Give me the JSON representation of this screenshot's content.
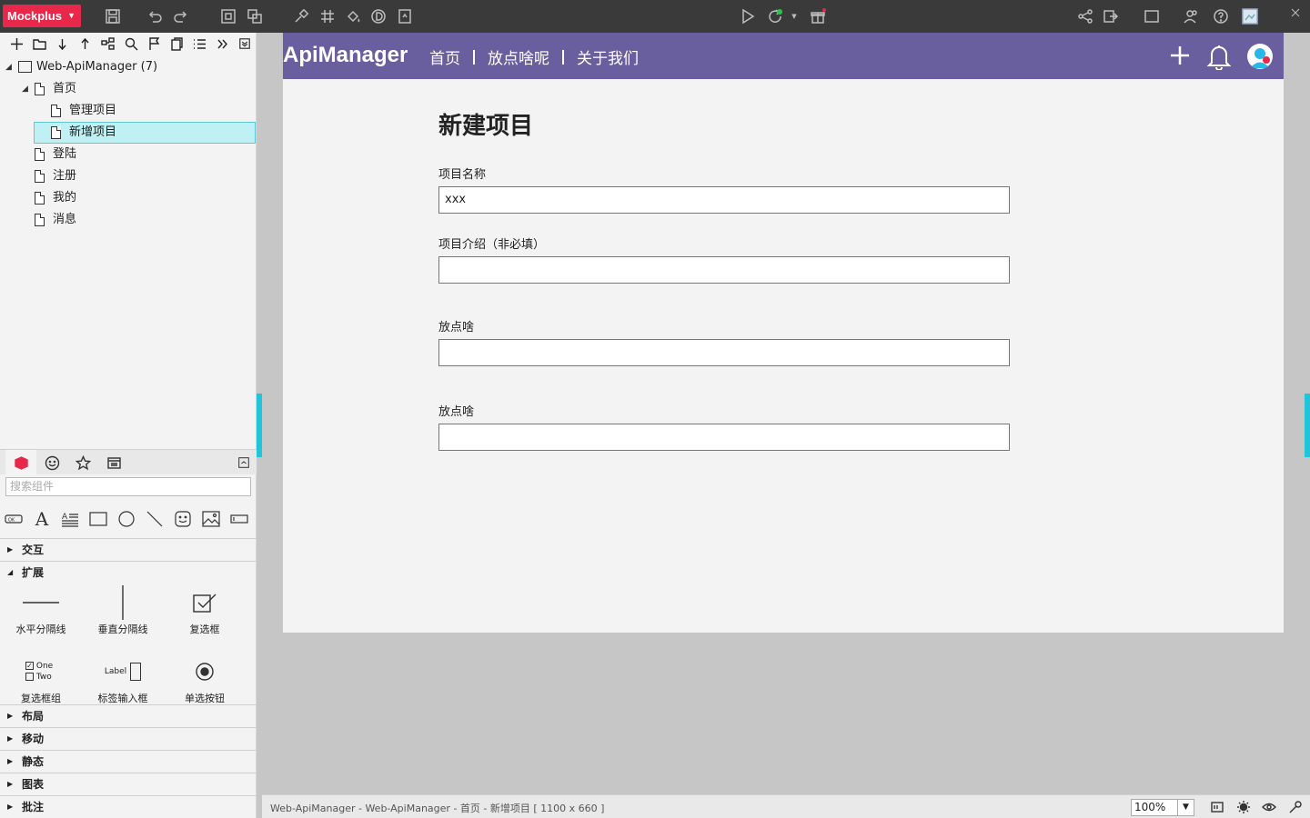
{
  "app": {
    "brand": "Mockplus"
  },
  "tree": {
    "root": "Web-ApiManager (7)",
    "items": [
      {
        "label": "首页"
      },
      {
        "label": "管理项目"
      },
      {
        "label": "新增项目"
      },
      {
        "label": "登陆"
      },
      {
        "label": "注册"
      },
      {
        "label": "我的"
      },
      {
        "label": "消息"
      }
    ]
  },
  "components": {
    "search_placeholder": "搜索组件",
    "categories": [
      "交互",
      "扩展",
      "布局",
      "移动",
      "静态",
      "图表",
      "批注"
    ],
    "extended": [
      "水平分隔线",
      "垂直分隔线",
      "复选框",
      "复选框组",
      "标签输入框",
      "单选按钮"
    ],
    "checkbox_group_options": [
      "One",
      "Two"
    ],
    "label_input_text": "Label"
  },
  "page": {
    "logo": "ApiManager",
    "nav": [
      "首页",
      "放点啥呢",
      "关于我们"
    ],
    "title": "新建项目",
    "fields": [
      {
        "label": "项目名称",
        "value": "xxx"
      },
      {
        "label": "项目介绍（非必填）",
        "value": ""
      },
      {
        "label": "放点啥",
        "value": ""
      },
      {
        "label": "放点啥",
        "value": ""
      }
    ]
  },
  "status": {
    "path": "Web-ApiManager - Web-ApiManager - 首页 - 新增项目 [ 1100 x 660 ]",
    "zoom": "100%"
  },
  "colors": {
    "brand": "#e8284a",
    "nav": "#6a5f9e",
    "accent": "#21c4d9"
  }
}
